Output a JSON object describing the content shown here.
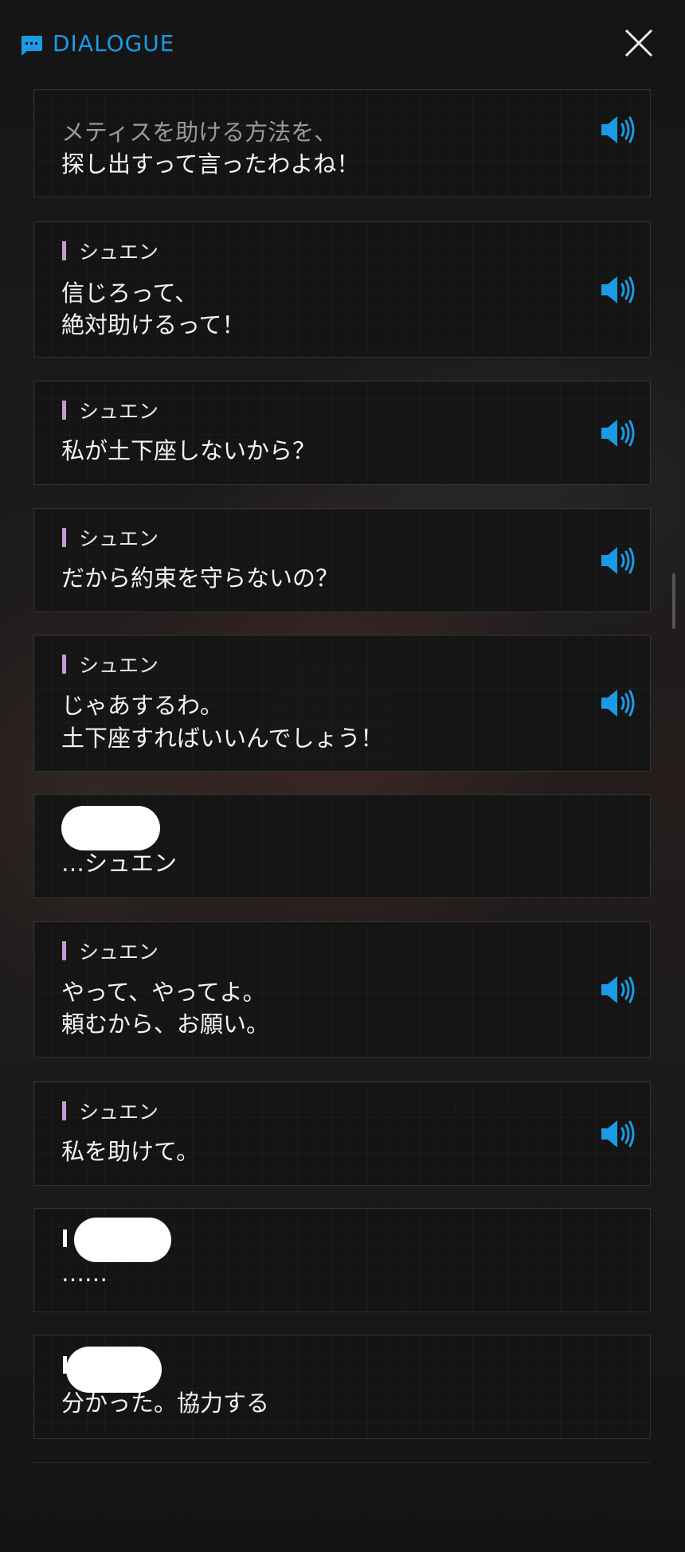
{
  "header": {
    "title": "DIALOGUE",
    "title_icon": "chat-bubble-icon",
    "close_icon": "close-icon",
    "accent_color": "#1a9be6"
  },
  "messages": [
    {
      "speaker": "",
      "lines": [
        "メティスを助ける方法を、",
        "探し出すって言ったわよね！"
      ],
      "voice": true
    },
    {
      "speaker": "シュエン",
      "lines": [
        "信じろって、",
        "絶対助けるって！"
      ],
      "voice": true
    },
    {
      "speaker": "シュエン",
      "lines": [
        "私が土下座しないから？"
      ],
      "voice": true
    },
    {
      "speaker": "シュエン",
      "lines": [
        "だから約束を守らないの？"
      ],
      "voice": true
    },
    {
      "speaker": "シュエン",
      "lines": [
        "じゃあするわ。",
        "土下座すればいいんでしょう！"
      ],
      "voice": true
    },
    {
      "speaker": "",
      "lines": [
        "…シュエン"
      ],
      "voice": false
    },
    {
      "speaker": "シュエン",
      "lines": [
        "やって、やってよ。",
        "頼むから、お願い。"
      ],
      "voice": true
    },
    {
      "speaker": "シュエン",
      "lines": [
        "私を助けて。"
      ],
      "voice": true
    },
    {
      "speaker": "",
      "lines": [
        "……"
      ],
      "voice": false
    },
    {
      "speaker": "",
      "lines": [
        "分かった。協力する"
      ],
      "voice": false
    }
  ],
  "colors": {
    "speaker_bar": "#c49ad8",
    "voice_icon": "#1a9be6",
    "card_bg": "#151515"
  }
}
